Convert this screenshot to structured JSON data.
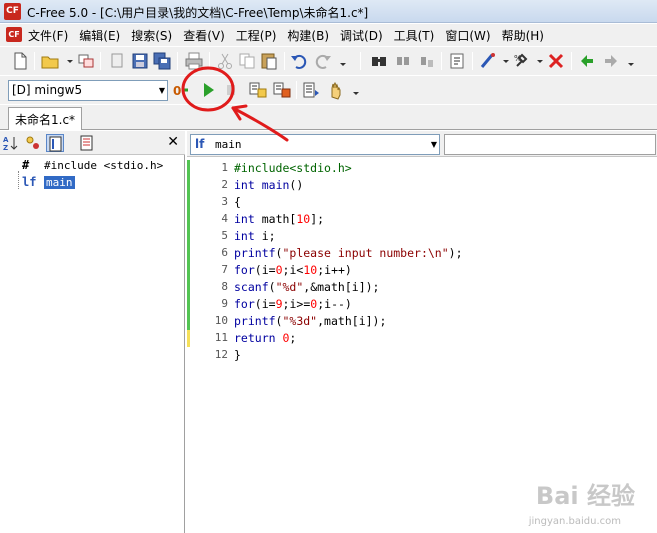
{
  "window": {
    "title": "C-Free 5.0 - [C:\\用户目录\\我的文档\\C-Free\\Temp\\未命名1.c*]",
    "app_icon": "CF"
  },
  "menu": {
    "items": [
      "文件(F)",
      "编辑(E)",
      "搜索(S)",
      "查看(V)",
      "工程(P)",
      "构建(B)",
      "调试(D)",
      "工具(T)",
      "窗口(W)",
      "帮助(H)"
    ]
  },
  "toolbar1": {
    "icons": [
      "new-file-icon",
      "open-folder-icon",
      "open-dropdown-icon",
      "save-icon",
      "save-all-icon",
      "print-icon",
      "cut-icon",
      "copy-icon",
      "paste-icon",
      "undo-icon",
      "redo-icon",
      "find-icon",
      "find-next-icon",
      "replace-icon",
      "bookmark-icon",
      "compile-tools-icon",
      "options-icon",
      "stop-icon",
      "back-arrow-icon",
      "forward-arrow-icon"
    ]
  },
  "toolbar2": {
    "compiler": "[D] mingw5",
    "icons": [
      "rebuild-icon",
      "run-icon",
      "stop-run-icon",
      "build-icon",
      "build-all-icon",
      "step-icon",
      "hand-icon"
    ]
  },
  "tabs": [
    {
      "label": "未命名1.c*"
    }
  ],
  "left_panel": {
    "icons": [
      "sort-az-icon",
      "group-icon",
      "class-view-icon",
      "file-view-icon",
      "close-icon"
    ],
    "tree": [
      {
        "icon": "#",
        "label": "#include <stdio.h>",
        "selected": false
      },
      {
        "icon": "lf",
        "label": "main",
        "selected": true
      }
    ]
  },
  "editor": {
    "function_icon": "lf",
    "function_select": "main",
    "lines": [
      {
        "n": "1",
        "text": "#include<stdio.h>",
        "bar": "green"
      },
      {
        "n": "2",
        "text": "int main()",
        "bar": "green"
      },
      {
        "n": "3",
        "text": "{",
        "bar": "green"
      },
      {
        "n": "4",
        "text": "int math[10];",
        "bar": "green"
      },
      {
        "n": "5",
        "text": "int i;",
        "bar": "green"
      },
      {
        "n": "6",
        "text": "printf(\"please input number:\\n\");",
        "bar": "green"
      },
      {
        "n": "7",
        "text": "for(i=0;i<10;i++)",
        "bar": "green"
      },
      {
        "n": "8",
        "text": "scanf(\"%d\",&math[i]);",
        "bar": "green"
      },
      {
        "n": "9",
        "text": "for(i=9;i>=0;i--)",
        "bar": "green"
      },
      {
        "n": "10",
        "text": "printf(\"%3d\",math[i]);",
        "bar": "green"
      },
      {
        "n": "11",
        "text": "return 0;",
        "bar": "yellow"
      },
      {
        "n": "12",
        "text": "}",
        "bar": "none"
      }
    ]
  },
  "watermark": {
    "main": "Bai 经验",
    "sub": "jingyan.baidu.com"
  },
  "colors": {
    "keyword": "#0000a0",
    "string": "#8b0000",
    "number": "#ff0000",
    "preprocessor": "#006400",
    "annotation": "#e01b1b"
  }
}
